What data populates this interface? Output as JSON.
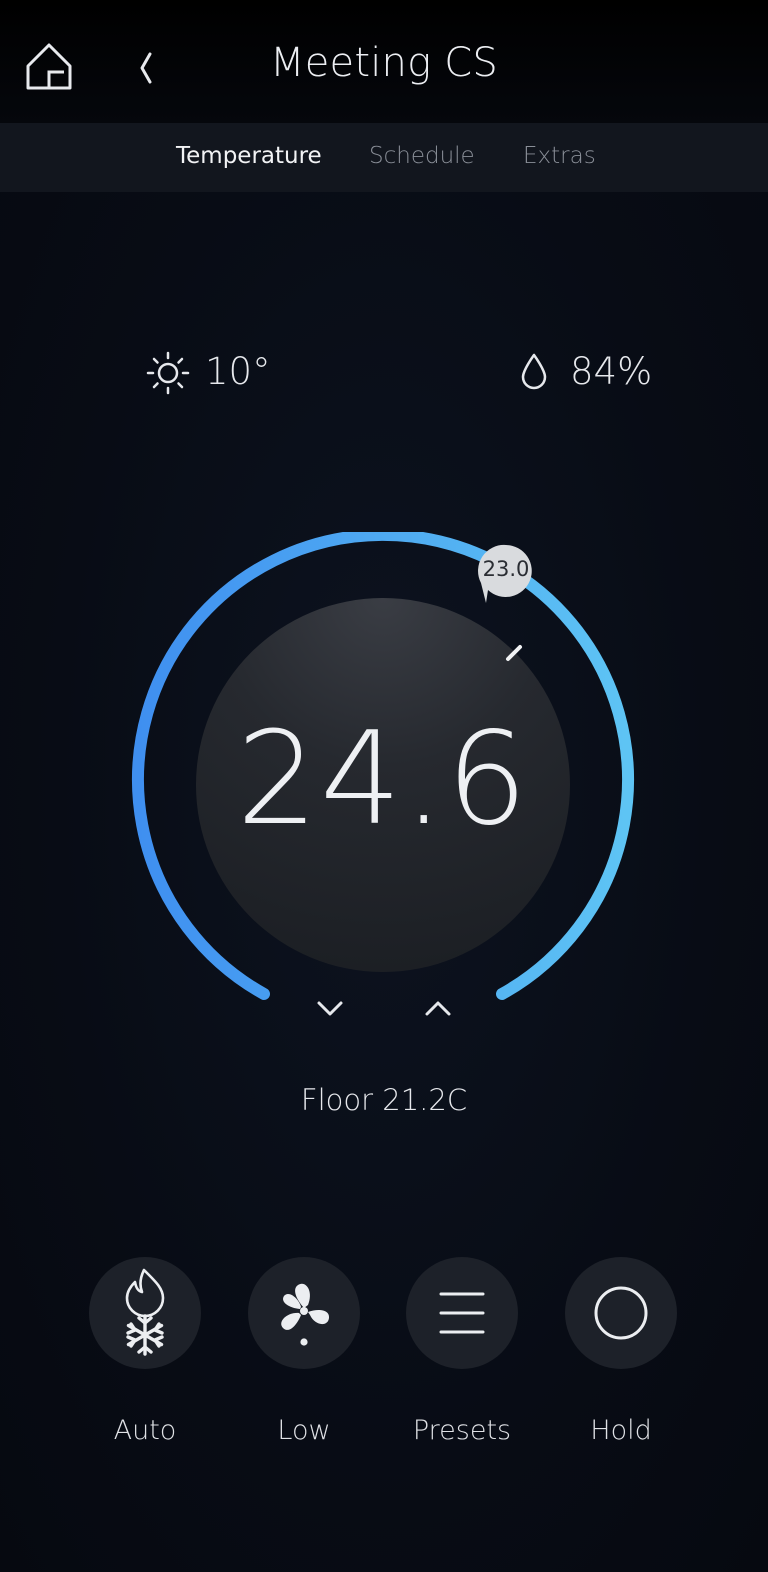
{
  "header": {
    "title": "Meeting CS",
    "home_icon": "home-icon",
    "back_icon": "chevron-left-icon"
  },
  "tabs": [
    {
      "label": "Temperature",
      "active": true
    },
    {
      "label": "Schedule",
      "active": false
    },
    {
      "label": "Extras",
      "active": false
    }
  ],
  "weather": {
    "outdoor_temp": "10°",
    "outdoor_icon": "sun-icon",
    "humidity": "84%",
    "humidity_icon": "droplet-icon"
  },
  "thermostat": {
    "current_temp": "24.6",
    "setpoint": "23.0",
    "floor": "Floor 21.2C",
    "down_icon": "chevron-down-icon",
    "up_icon": "chevron-up-icon"
  },
  "controls": [
    {
      "label": "Auto",
      "icon": "flame-snowflake-icon"
    },
    {
      "label": "Low",
      "icon": "fan-icon"
    },
    {
      "label": "Presets",
      "icon": "menu-lines-icon"
    },
    {
      "label": "Hold",
      "icon": "circle-icon"
    }
  ],
  "colors": {
    "background": "#070b14",
    "arc_start": "#3f8ff0",
    "arc_end": "#5ec4f4",
    "inner_dial": "#2a2d33",
    "button_bg": "#1d2129"
  }
}
